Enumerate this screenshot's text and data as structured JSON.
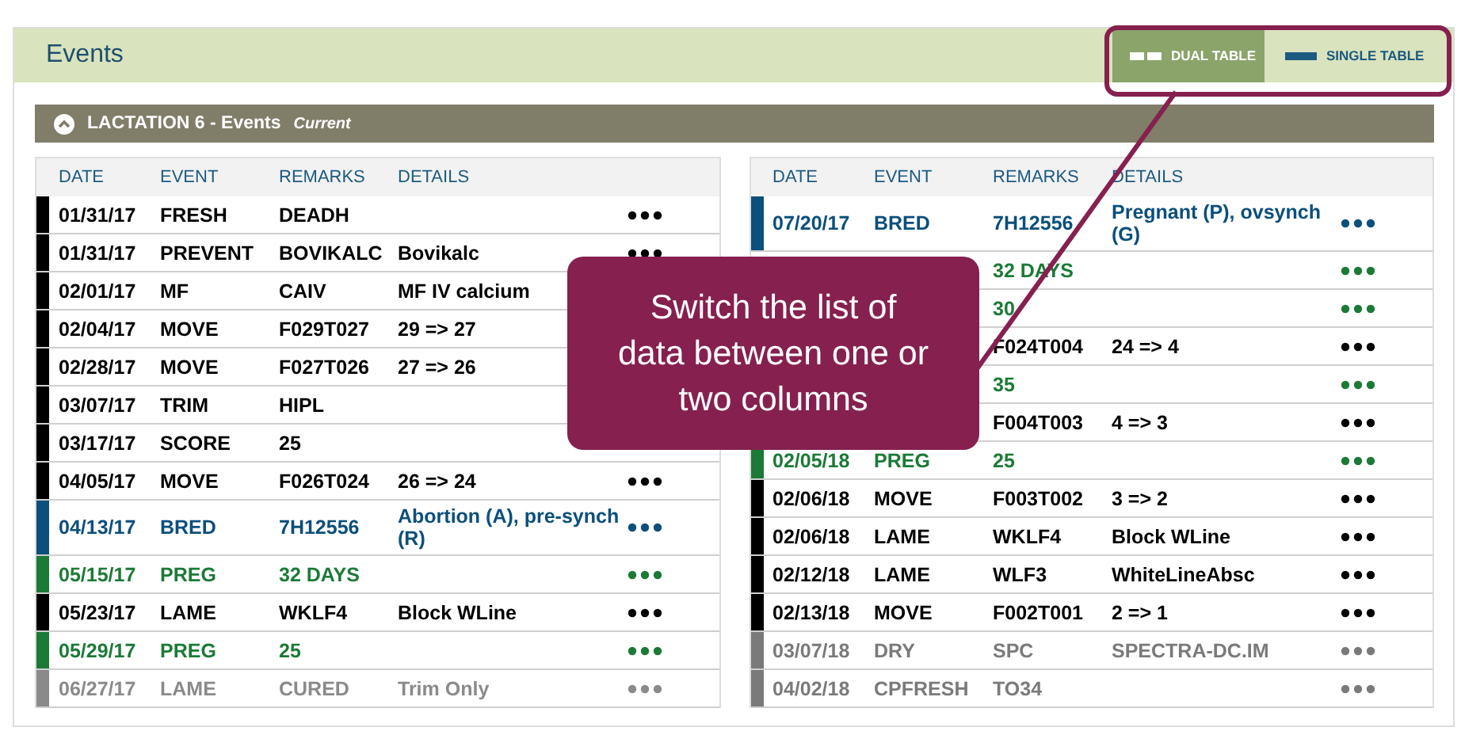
{
  "panel": {
    "title": "Events"
  },
  "view_toggle": [
    {
      "label": "DUAL TABLE",
      "kind": "dual",
      "selected": true
    },
    {
      "label": "SINGLE TABLE",
      "kind": "single",
      "selected": false
    }
  ],
  "lactation": {
    "title": "LACTATION 6 - Events",
    "status": "Current",
    "expanded": true
  },
  "tables": [
    {
      "columns": [
        "DATE",
        "EVENT",
        "REMARKS",
        "DETAILS"
      ],
      "rows": [
        {
          "date": "01/31/17",
          "event": "FRESH",
          "remarks": "DEADH",
          "color": "#000000",
          "menu": true
        },
        {
          "date": "01/31/17",
          "event": "PREVENT",
          "remarks": "BOVIKALC",
          "details": "Bovikalc",
          "color": "#000000",
          "menu": true
        },
        {
          "date": "02/01/17",
          "event": "MF",
          "remarks": "CAIV",
          "details": "MF IV calcium",
          "color": "#000000",
          "menu": false
        },
        {
          "date": "02/04/17",
          "event": "MOVE",
          "remarks": "F029T027",
          "details": "29 => 27",
          "color": "#000000",
          "menu": false
        },
        {
          "date": "02/28/17",
          "event": "MOVE",
          "remarks": "F027T026",
          "details": "27 => 26",
          "color": "#000000",
          "menu": false
        },
        {
          "date": "03/07/17",
          "event": "TRIM",
          "remarks": "HIPL",
          "color": "#000000",
          "menu": false
        },
        {
          "date": "03/17/17",
          "event": "SCORE",
          "remarks": "25",
          "color": "#000000",
          "menu": false
        },
        {
          "date": "04/05/17",
          "event": "MOVE",
          "remarks": "F026T024",
          "details": "26 => 24",
          "color": "#000000",
          "menu": true
        },
        {
          "date": "04/13/17",
          "event": "BRED",
          "remarks": "7H12556",
          "details": "Abortion (A), pre-synch (R)",
          "color": "#0b4f7c",
          "menu": true
        },
        {
          "date": "05/15/17",
          "event": "PREG",
          "remarks": "32 DAYS",
          "color": "#1b7a36",
          "menu": true
        },
        {
          "date": "05/23/17",
          "event": "LAME",
          "remarks": "WKLF4",
          "details": "Block WLine",
          "color": "#000000",
          "menu": true
        },
        {
          "date": "05/29/17",
          "event": "PREG",
          "remarks": "25",
          "color": "#1b7a36",
          "menu": true
        },
        {
          "date": "06/27/17",
          "event": "LAME",
          "remarks": "CURED",
          "details": "Trim Only",
          "color": "#8a8a8a",
          "menu": true
        }
      ]
    },
    {
      "columns": [
        "DATE",
        "EVENT",
        "REMARKS",
        "DETAILS"
      ],
      "rows": [
        {
          "date": "07/20/17",
          "event": "BRED",
          "remarks": "7H12556",
          "details": "Pregnant (P), ovsynch (G)",
          "color": "#0b4f7c",
          "menu": true
        },
        {
          "remarks": "32 DAYS",
          "color": "#1b7a36",
          "menu": true
        },
        {
          "remarks": "30",
          "color": "#1b7a36",
          "menu": true
        },
        {
          "remarks": "F024T004",
          "details": "24 => 4",
          "color": "#000000",
          "menu": true
        },
        {
          "remarks": "35",
          "color": "#1b7a36",
          "menu": true
        },
        {
          "remarks": "F004T003",
          "details": "4 => 3",
          "color": "#000000",
          "menu": true
        },
        {
          "date": "02/05/18",
          "event": "PREG",
          "remarks": "25",
          "color": "#1b7a36",
          "menu": true
        },
        {
          "date": "02/06/18",
          "event": "MOVE",
          "remarks": "F003T002",
          "details": "3 => 2",
          "color": "#000000",
          "menu": true
        },
        {
          "date": "02/06/18",
          "event": "LAME",
          "remarks": "WKLF4",
          "details": "Block WLine",
          "color": "#000000",
          "menu": true
        },
        {
          "date": "02/12/18",
          "event": "LAME",
          "remarks": "WLF3",
          "details": "WhiteLineAbsc",
          "color": "#000000",
          "menu": true
        },
        {
          "date": "02/13/18",
          "event": "MOVE",
          "remarks": "F002T001",
          "details": "2 => 1",
          "color": "#000000",
          "menu": true
        },
        {
          "date": "03/07/18",
          "event": "DRY",
          "remarks": "SPC",
          "details": "SPECTRA-DC.IM",
          "color": "#7a7a7a",
          "menu": true
        },
        {
          "date": "04/02/18",
          "event": "CPFRESH",
          "remarks": "TO34",
          "color": "#7a7a7a",
          "menu": true
        }
      ]
    }
  ],
  "callout": {
    "text": "Switch the list of data between one or two columns"
  }
}
